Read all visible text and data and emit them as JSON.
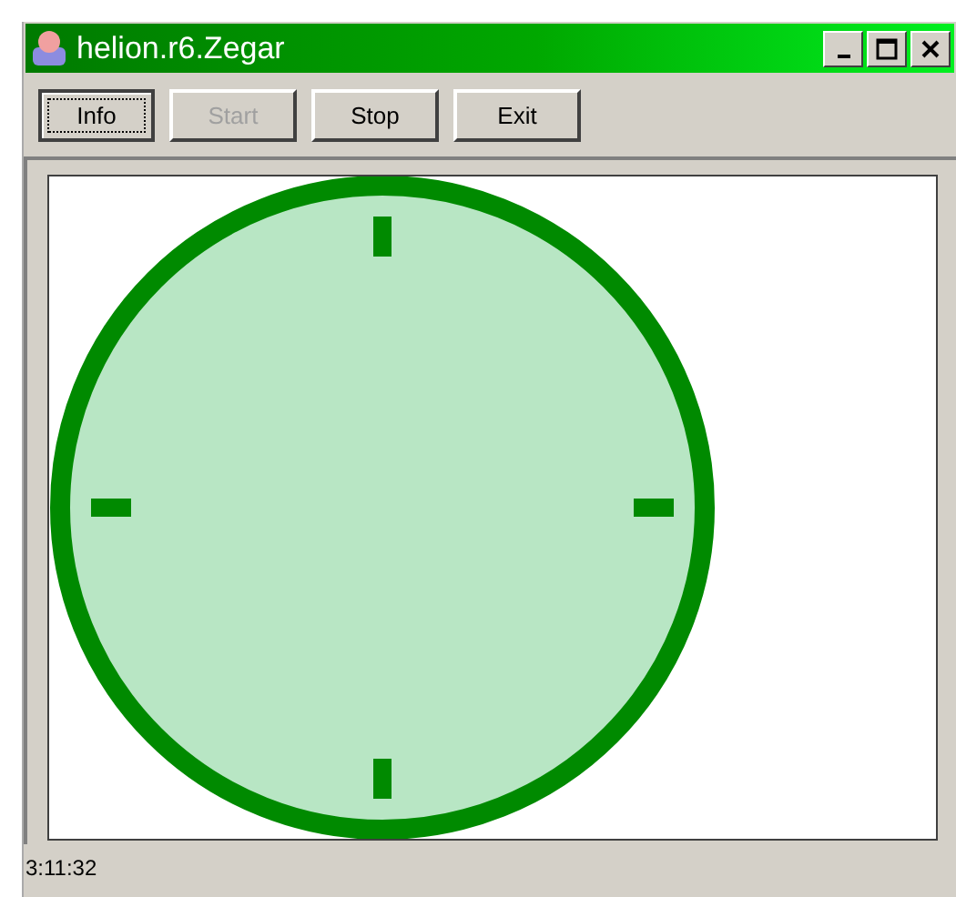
{
  "window": {
    "title": "helion.r6.Zegar"
  },
  "buttons": [
    {
      "label": "Info",
      "disabled": false,
      "focused": true
    },
    {
      "label": "Start",
      "disabled": true,
      "focused": false
    },
    {
      "label": "Stop",
      "disabled": false,
      "focused": false
    },
    {
      "label": "Exit",
      "disabled": false,
      "focused": false
    }
  ],
  "status_bar": {
    "text": "3:11:32"
  }
}
